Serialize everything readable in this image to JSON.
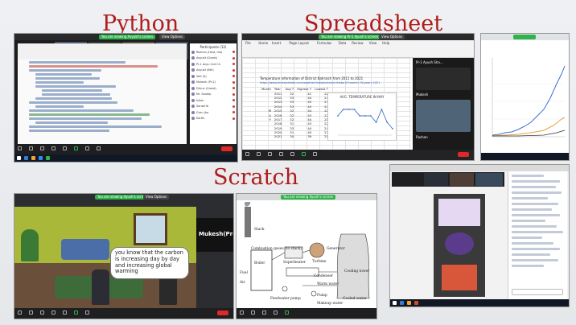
{
  "headings": {
    "python": "Python",
    "spreadsheet": "Spreadsheet",
    "scratch": "Scratch"
  },
  "python_shot": {
    "recording_badge": "You are viewing Avyukt's screen",
    "view_options": "View Options",
    "presenter_name": "Roshan",
    "participants_title": "Participants (12)",
    "participants": [
      "Roshan (Host, me)",
      "Avyukt (Guest)",
      "Pr-1 Avyu 2nd Ch",
      "Avyukt (6th)",
      "Ved (5)",
      "Mukesh (Pr-2)",
      "Dhruv (Guest)",
      "Mr. Sandip",
      "Ishan",
      "Sanskriti",
      "Guru Jha",
      "Kartik"
    ]
  },
  "spreadsheet_shot": {
    "recording_badge": "You are viewing Pr-1 Ayush's screen",
    "view_options": "View Options",
    "ribbon_tabs": [
      "File",
      "Home",
      "Insert",
      "Page Layout",
      "Formulas",
      "Data",
      "Review",
      "View",
      "Help"
    ],
    "sheet_title": "Temperature information of District Bahraich from 2011 to 2021",
    "sheet_link": "https://www.timeanddate.com/weather/india/bahraich/historic?month=5&year=2021",
    "table_headers": [
      "Month",
      "Year",
      "Avg T",
      "Highest T",
      "Lowest T"
    ],
    "table_rows": [
      [
        "",
        "2011",
        "32",
        "41",
        "22"
      ],
      [
        "",
        "2012",
        "33",
        "44",
        "24"
      ],
      [
        "",
        "2013",
        "33",
        "43",
        "23"
      ],
      [
        "",
        "2014",
        "33",
        "43",
        "24"
      ],
      [
        "M",
        "2015",
        "32",
        "44",
        "22"
      ],
      [
        "A",
        "2016",
        "32",
        "43",
        "22"
      ],
      [
        "Y",
        "2017",
        "32",
        "44",
        "21"
      ],
      [
        "",
        "2018",
        "31",
        "43",
        "22"
      ],
      [
        "",
        "2019",
        "33",
        "44",
        "24"
      ],
      [
        "",
        "2020",
        "31",
        "40",
        "23"
      ],
      [
        "",
        "2021",
        "30",
        "39",
        "21"
      ]
    ],
    "chart_title": "AVG. TEMPERATURE IN MAY",
    "video_label_1": "Pr-1 Ayush Sha...",
    "video_label_2": "Mukesh",
    "video_label_3": "Roshan"
  },
  "scratch_shot": {
    "recording_badge": "You are viewing Ayush's screen",
    "view_options": "View Options",
    "speech_bubble": "you know that the carbon is increasing day by day and increasing global warming",
    "participant_name": "Mukesh(Pr-2)"
  },
  "diagram_shot": {
    "recording_badge": "You are viewing Ayush's screen",
    "labels": [
      "Stack",
      "Combustion gases (to stack)",
      "Superheater",
      "Fuel",
      "Air",
      "Turbine",
      "Generator",
      "Condenser",
      "Cooling tower",
      "Warm water",
      "Cooled water",
      "Pump",
      "Feedwater pump",
      "Makeup water",
      "Boiler"
    ]
  },
  "colors": {
    "heading": "#b01c1c",
    "zoom_green": "#2fb34a",
    "end_button": "#e02828",
    "scratch_wall": "#aab83a"
  }
}
